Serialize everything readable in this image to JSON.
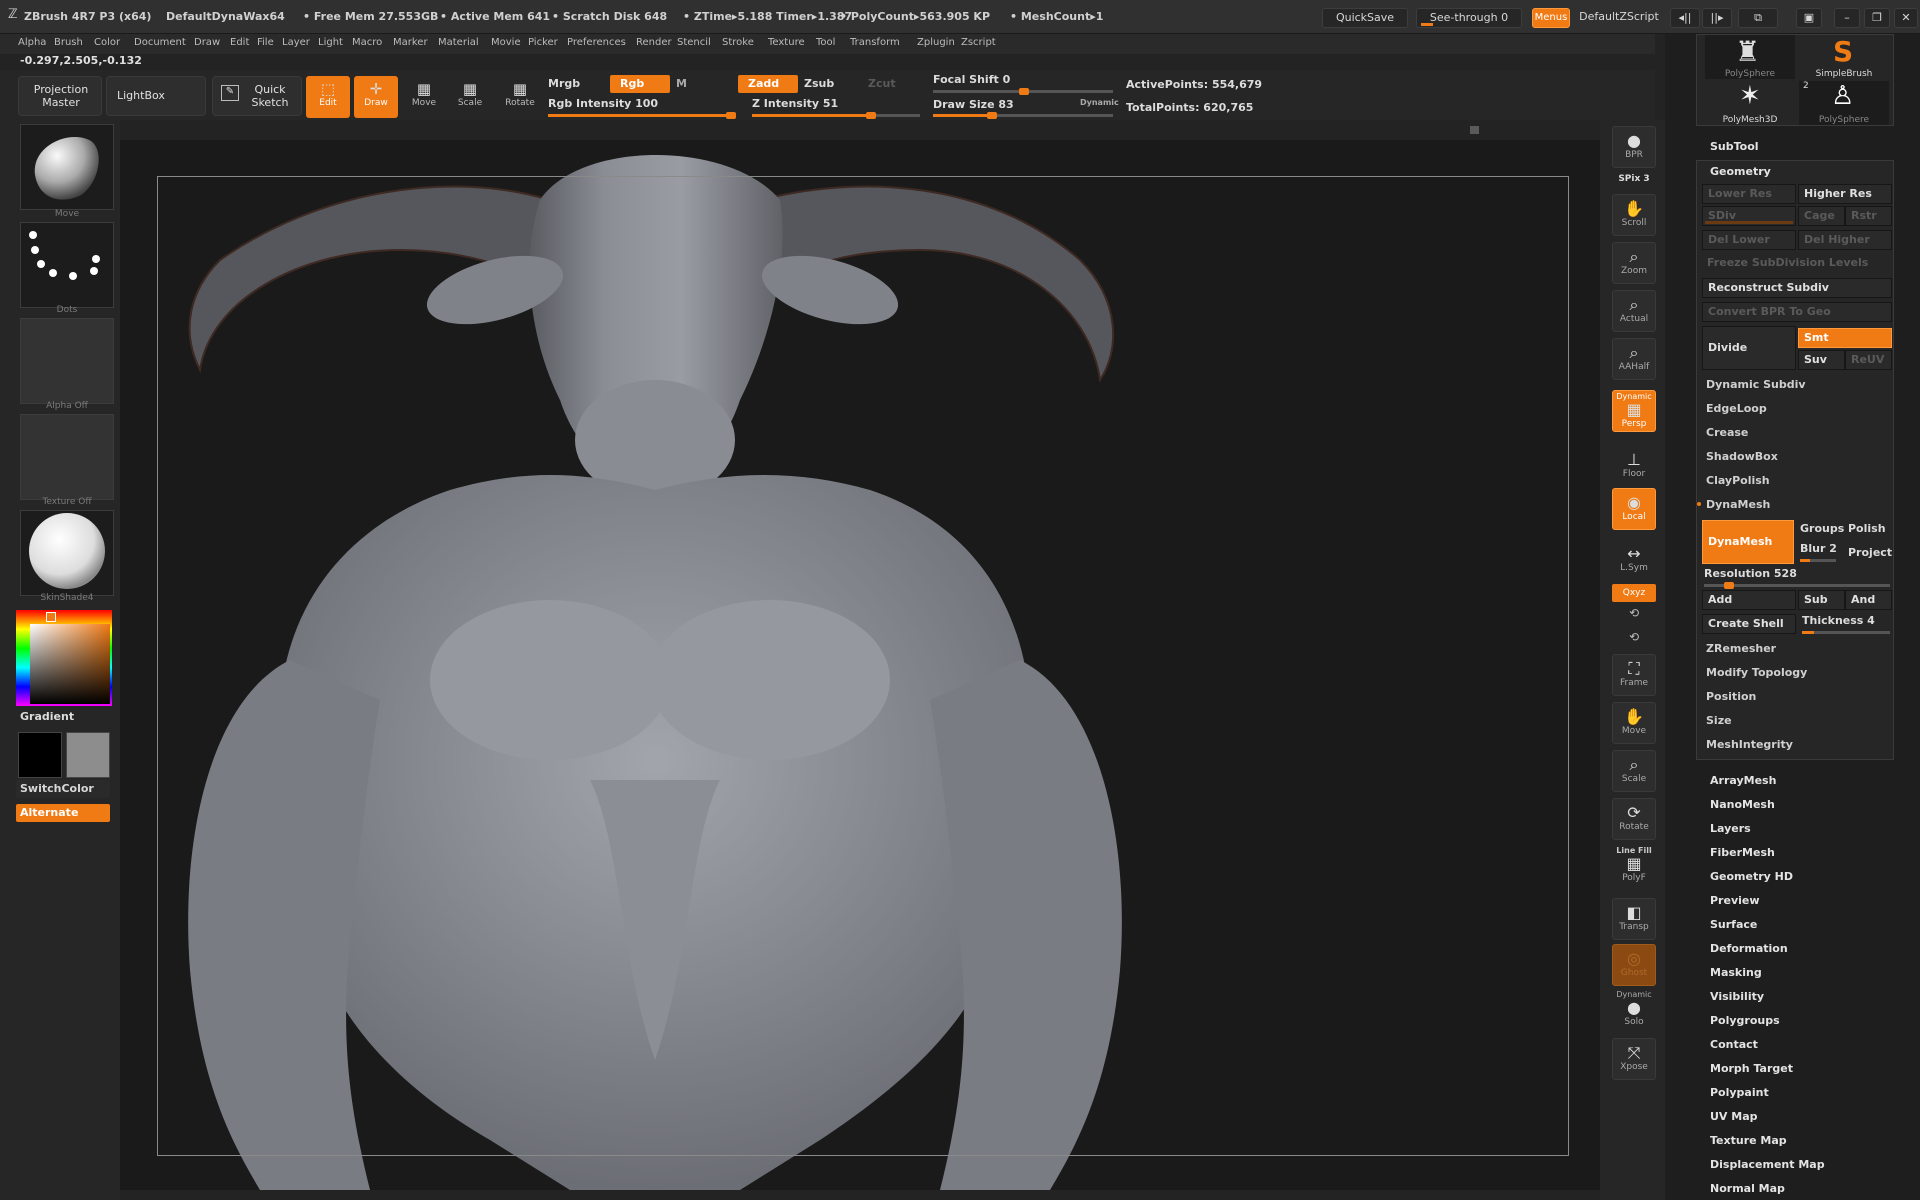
{
  "titlebar": {
    "app": "ZBrush 4R7 P3 (x64)",
    "document": "DefaultDynaWax64",
    "free_mem": "• Free Mem 27.553GB",
    "active_mem": "• Active Mem 641",
    "scratch_disk": "• Scratch Disk 648",
    "ztime": "• ZTime▸5.188 Timer▸1.387",
    "polycount": "• PolyCount▸563.905 KP",
    "meshcount": "• MeshCount▸1",
    "quicksave": "QuickSave",
    "see_through": "See-through  0",
    "menus": "Menus",
    "zscript": "DefaultZScript"
  },
  "menubar": [
    "Alpha",
    "Brush",
    "Color",
    "Document",
    "Draw",
    "Edit",
    "File",
    "Layer",
    "Light",
    "Macro",
    "Marker",
    "Material",
    "Movie",
    "Picker",
    "Preferences",
    "Render",
    "Stencil",
    "Stroke",
    "Texture",
    "Tool",
    "Transform",
    "Zplugin",
    "Zscript"
  ],
  "coords": "-0.297,2.505,-0.132",
  "toolbar": {
    "projection_master": "Projection Master",
    "lightbox": "LightBox",
    "quick_sketch": "Quick Sketch",
    "edit": "Edit",
    "draw": "Draw",
    "move": "Move",
    "scale": "Scale",
    "rotate": "Rotate",
    "mrgb": "Mrgb",
    "rgb": "Rgb",
    "m": "M",
    "zadd": "Zadd",
    "zsub": "Zsub",
    "zcut": "Zcut",
    "rgb_intensity": "Rgb Intensity 100",
    "z_intensity": "Z Intensity 51",
    "focal_shift": "Focal Shift 0",
    "draw_size": "Draw Size 83",
    "dynamic": "Dynamic",
    "active_points": "ActivePoints: 554,679",
    "total_points": "TotalPoints: 620,765",
    "rgb_intensity_value": 100,
    "z_intensity_value": 51,
    "focal_shift_value": 0,
    "draw_size_value": 83
  },
  "leftshelf": {
    "brush": "Move",
    "stroke": "Dots",
    "alpha": "Alpha Off",
    "texture": "Texture Off",
    "material": "SkinShade4",
    "gradient": "Gradient",
    "switchcolor": "SwitchColor",
    "alternate": "Alternate"
  },
  "rightshelf": {
    "bpr": "BPR",
    "spix": "SPix 3",
    "scroll": "Scroll",
    "zoom": "Zoom",
    "actual": "Actual",
    "aahalf": "AAHalf",
    "dynamic": "Dynamic",
    "persp": "Persp",
    "floor": "Floor",
    "local": "Local",
    "lsym": "L.Sym",
    "xyz": "Qxyz",
    "frame": "Frame",
    "move": "Move",
    "scale": "Scale",
    "rotate": "Rotate",
    "line_fill": "Line Fill",
    "polyf": "PolyF",
    "transp": "Transp",
    "ghost": "Ghost",
    "solo_dynamic": "Dynamic",
    "solo": "Solo",
    "xpose": "Xpose"
  },
  "toolpanel": {
    "tools": [
      {
        "label": "PolySphere"
      },
      {
        "label": "SimpleBrush"
      },
      {
        "label": "PolyMesh3D"
      },
      {
        "label": "PolySphere",
        "badge": "2"
      }
    ],
    "subtool": "SubTool",
    "geometry": "Geometry",
    "lower_res": "Lower Res",
    "higher_res": "Higher Res",
    "sdiv": "SDiv",
    "cage": "Cage",
    "rstr": "Rstr",
    "del_lower": "Del Lower",
    "del_higher": "Del Higher",
    "freeze": "Freeze SubDivision Levels",
    "reconstruct": "Reconstruct Subdiv",
    "convert_bpr": "Convert BPR To Geo",
    "divide": "Divide",
    "smt": "Smt",
    "suv": "Suv",
    "reuv": "ReUV",
    "dynamic_subdiv": "Dynamic Subdiv",
    "edgeloop": "EdgeLoop",
    "crease": "Crease",
    "shadowbox": "ShadowBox",
    "claypolish": "ClayPolish",
    "dynamesh_header": "DynaMesh",
    "dynamesh_btn": "DynaMesh",
    "groups": "Groups",
    "polish": "Polish",
    "blur": "Blur 2",
    "project": "Project",
    "resolution": "Resolution 528",
    "add": "Add",
    "sub": "Sub",
    "and": "And",
    "create_shell": "Create Shell",
    "thickness": "Thickness 4",
    "zremesher": "ZRemesher",
    "modify_topology": "Modify Topology",
    "position": "Position",
    "size": "Size",
    "meshintegrity": "MeshIntegrity",
    "menu": [
      "ArrayMesh",
      "NanoMesh",
      "Layers",
      "FiberMesh",
      "Geometry HD",
      "Preview",
      "Surface",
      "Deformation",
      "Masking",
      "Visibility",
      "Polygroups",
      "Contact",
      "Morph Target",
      "Polypaint",
      "UV Map",
      "Texture Map",
      "Displacement Map",
      "Normal Map"
    ]
  },
  "colors": {
    "accent": "#f07a14",
    "background": "#262626",
    "canvas": "#1a1a1a",
    "model": "#8a8c93"
  }
}
